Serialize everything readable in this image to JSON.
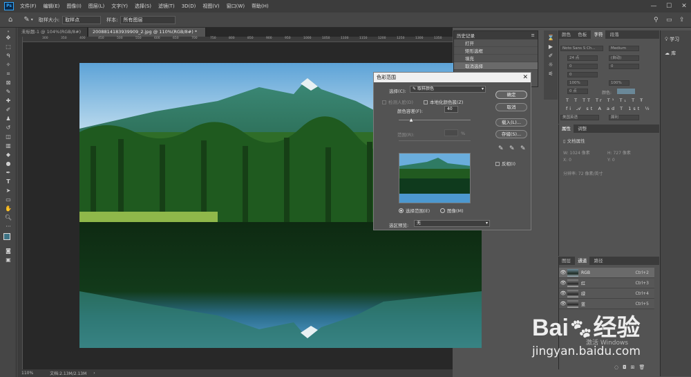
{
  "menubar": {
    "logo": "Ps",
    "items": [
      "文件(F)",
      "编辑(E)",
      "图像(I)",
      "图层(L)",
      "文字(Y)",
      "选择(S)",
      "滤镜(T)",
      "3D(D)",
      "视图(V)",
      "窗口(W)",
      "帮助(H)"
    ],
    "min": "—",
    "max": "☐",
    "close": "✕"
  },
  "options": {
    "sample_size_label": "取样大小:",
    "sample_size_value": "取样点",
    "sample_label": "样本:",
    "sample_value": "所有图层"
  },
  "tabs": [
    {
      "label": "未标题-1 @ 104%(RGB/8#) *",
      "close": "×"
    },
    {
      "label": "2008814183939909_2.jpg @ 110%(RGB/8#) *",
      "close": "×"
    }
  ],
  "rulers": {
    "h": [
      "300",
      "350",
      "400",
      "450",
      "500",
      "550",
      "600",
      "650",
      "700",
      "750",
      "800",
      "850",
      "900",
      "950",
      "1000",
      "1050",
      "1100",
      "1150",
      "1200",
      "1250",
      "1300",
      "1350"
    ]
  },
  "status": {
    "zoom": "110%",
    "doc": "文档:2.13M/2.13M",
    "arrow": "›"
  },
  "history": {
    "title": "历史记录",
    "items": [
      "打开",
      "矩形选框",
      "填充",
      "取消选择"
    ]
  },
  "right_rail": {
    "learn": "学习",
    "library": "库"
  },
  "character": {
    "tabs": [
      "颜色",
      "色板",
      "字符",
      "段落"
    ],
    "font": "Noto Sans S Ch...",
    "style": "Medium",
    "size": "24 点",
    "leading": "(自动)",
    "tracking": "0",
    "kerning": "0",
    "vscale": "100%",
    "hscale": "100%",
    "baseline": "0 点",
    "color_label": "颜色:",
    "aa_label": "美国英语",
    "aa_value": "犀利",
    "glyphs": [
      "T",
      "T",
      "TT",
      "Tr",
      "T¹",
      "T₁",
      "T",
      "Ŧ"
    ],
    "glyphs2": [
      "fi",
      "𝒜",
      "st",
      "A",
      "ad",
      "T",
      "1st",
      "½"
    ]
  },
  "properties": {
    "tabs": [
      "属性",
      "调整"
    ],
    "doc_props": "文档属性",
    "w_label": "W:",
    "w_value": "1024 像素",
    "h_label": "H:",
    "h_value": "727 像素",
    "x_label": "X:",
    "x_value": "0",
    "y_label": "Y:",
    "y_value": "0",
    "res": "分辨率: 72 像素/英寸"
  },
  "channels": {
    "tabs": [
      "图层",
      "通道",
      "路径"
    ],
    "rows": [
      {
        "name": "RGB",
        "shortcut": "Ctrl+2"
      },
      {
        "name": "红",
        "shortcut": "Ctrl+3"
      },
      {
        "name": "绿",
        "shortcut": "Ctrl+4"
      },
      {
        "name": "蓝",
        "shortcut": "Ctrl+5"
      }
    ]
  },
  "dialog": {
    "title": "色彩范围",
    "select_label": "选择(C):",
    "select_value": "取样颜色",
    "detect_faces": "检测人脸(D)",
    "localized": "本地化颜色簇(Z)",
    "fuzziness_label": "颜色容差(F):",
    "fuzziness_value": "40",
    "fuzziness_fraction": 0.18,
    "range_label": "范围(R):",
    "range_unit": "%",
    "ok": "确定",
    "cancel": "取消",
    "load": "载入(L)...",
    "save": "存储(S)...",
    "invert": "反相(I)",
    "radio_selection": "选择范围(E)",
    "radio_image": "图像(M)",
    "preview_label": "选区预览:",
    "preview_value": "无"
  },
  "watermark": {
    "brand_left": "Bai",
    "brand_right": "经验",
    "url": "jingyan.baidu.com",
    "activate": "激活 Windows"
  }
}
